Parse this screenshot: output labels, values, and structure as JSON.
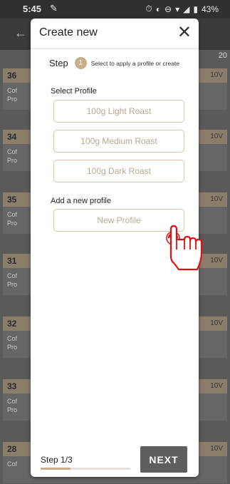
{
  "status_bar": {
    "time": "5:45",
    "battery": "43%"
  },
  "background": {
    "top_right_number": "20",
    "cards": [
      {
        "num": "36",
        "volt": "10V",
        "line1": "Cof",
        "line2": "Pro"
      },
      {
        "num": "34",
        "volt": "10V",
        "line1": "Cof",
        "line2": "Pro"
      },
      {
        "num": "35",
        "volt": "10V",
        "line1": "Cof",
        "line2": "Pro"
      },
      {
        "num": "31",
        "volt": "10V",
        "line1": "Cof",
        "line2": "Pro"
      },
      {
        "num": "32",
        "volt": "10V",
        "line1": "Cof",
        "line2": "Pro"
      },
      {
        "num": "33",
        "volt": "10V",
        "line1": "Cof",
        "line2": "Pro"
      },
      {
        "num": "28",
        "volt": "10V",
        "line1": "Cof",
        "line2": ""
      }
    ]
  },
  "dialog": {
    "title": "Create new",
    "step_label": "Step",
    "step_number": "1",
    "step_hint": "Select to apply a profile or create",
    "select_profile_label": "Select Profile",
    "profiles": [
      "100g Light Roast",
      "100g Medium Roast",
      "100g Dark Roast"
    ],
    "add_profile_label": "Add a new profile",
    "new_profile_label": "New Profile",
    "footer_step": "Step 1/3",
    "progress": 0.33,
    "next_label": "NEXT"
  },
  "colors": {
    "accent": "#c7ad8a",
    "button_border": "#d8c6a9",
    "next_button": "#5e5e5e"
  },
  "icons": [
    "back-arrow-icon",
    "close-icon",
    "hand-pointer-icon"
  ]
}
